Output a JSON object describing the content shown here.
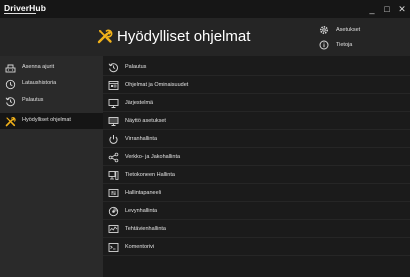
{
  "app": {
    "logo_text": "DriverHub"
  },
  "window_controls": {
    "minimize": "_",
    "maximize": "□",
    "close": "✕"
  },
  "header": {
    "title": "Hyödylliset ohjelmat",
    "title_icon": "tools-icon",
    "accent_color": "#f2b21a"
  },
  "top_menu": [
    {
      "label": "Asetukset",
      "icon": "gear-icon"
    },
    {
      "label": "Tietoja",
      "icon": "info-icon"
    }
  ],
  "sidebar": {
    "items": [
      {
        "label": "Asenna ajurit",
        "icon": "install-drivers-icon"
      },
      {
        "label": "Lataushistoria",
        "icon": "history-clock-icon"
      },
      {
        "label": "Palautus",
        "icon": "restore-icon"
      },
      {
        "label": "Hyödylliset ohjelmat",
        "icon": "tools-icon",
        "active": true
      }
    ]
  },
  "main": {
    "items": [
      {
        "label": "Palautus",
        "icon": "restore-icon"
      },
      {
        "label": "Ohjelmat ja Ominaisuudet",
        "icon": "programs-icon"
      },
      {
        "label": "Järjestelmä",
        "icon": "system-monitor-icon"
      },
      {
        "label": "Näyttö asetukset",
        "icon": "display-icon"
      },
      {
        "label": "Virranhallinta",
        "icon": "power-icon"
      },
      {
        "label": "Verkko- ja Jakohallinta",
        "icon": "network-icon"
      },
      {
        "label": "Tietokoneen Hallinta",
        "icon": "computer-management-icon"
      },
      {
        "label": "Hallintapaneeli",
        "icon": "control-panel-icon"
      },
      {
        "label": "Levynhallinta",
        "icon": "disk-icon"
      },
      {
        "label": "Tehtävienhallinta",
        "icon": "task-manager-icon"
      },
      {
        "label": "Komentorivi",
        "icon": "command-prompt-icon"
      }
    ]
  }
}
